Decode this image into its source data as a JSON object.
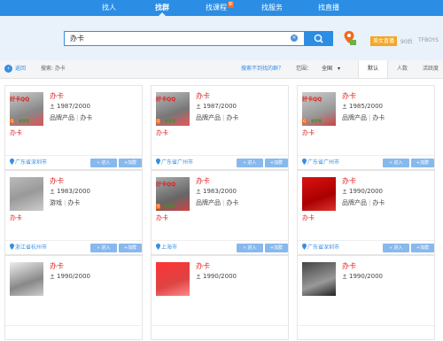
{
  "nav": {
    "tabs": [
      {
        "label": "找人"
      },
      {
        "label": "找群",
        "active": true
      },
      {
        "label": "找课程",
        "badge": "新"
      },
      {
        "label": "找服务"
      },
      {
        "label": "找直播"
      }
    ],
    "accent": "#2b8de3"
  },
  "search": {
    "query": "办卡",
    "live_badge": "美女直播",
    "hot_1": "90后",
    "hot_2": "TFBOYS"
  },
  "filter": {
    "back_label": "返回",
    "search_label": "搜索: 办卡",
    "not_found_question": "搜索不到找的群？",
    "range_label": "范围：",
    "range_value": "全国",
    "sort_default": "默认",
    "sort_people": "人数",
    "sort_active": "活跃度"
  },
  "cards": [
    {
      "name": "办卡",
      "members": "1987/2000",
      "tags": [
        "品牌产品",
        "办卡"
      ],
      "keyword": "办卡",
      "location": "广东省深圳市",
      "enter": "» 进入",
      "join": "+加群",
      "avatar_text": "好卡QQ"
    },
    {
      "name": "办卡",
      "members": "1987/2000",
      "tags": [
        "品牌产品",
        "办卡"
      ],
      "keyword": "办卡",
      "location": "广东省广州市",
      "enter": "» 进入",
      "join": "+加群",
      "avatar_text": "好卡QQ"
    },
    {
      "name": "办卡",
      "members": "1985/2000",
      "tags": [
        "品牌产品",
        "办卡"
      ],
      "keyword": "办卡",
      "location": "广东省广州市",
      "enter": "» 进入",
      "join": "+加群",
      "avatar_text": "好卡QQ"
    },
    {
      "name": "办卡",
      "members": "1983/2000",
      "tags": [
        "游戏",
        "办卡"
      ],
      "keyword": "办卡",
      "location": "浙江省杭州市",
      "enter": "» 进入",
      "join": "+加群",
      "avatar_text": ""
    },
    {
      "name": "办卡",
      "members": "1983/2000",
      "tags": [
        "品牌产品",
        "办卡"
      ],
      "keyword": "办卡",
      "location": "上海市",
      "enter": "» 进入",
      "join": "+加群",
      "avatar_text": "好卡QQ"
    },
    {
      "name": "办卡",
      "members": "1990/2000",
      "tags": [
        "品牌产品",
        "办卡"
      ],
      "keyword": "办卡",
      "location": "广东省深圳市",
      "enter": "» 进入",
      "join": "+加群",
      "avatar_text": ""
    },
    {
      "name": "办卡",
      "members": "1990/2000",
      "tags": [],
      "keyword": "",
      "location": "",
      "enter": "",
      "join": "",
      "avatar_text": ""
    },
    {
      "name": "办卡",
      "members": "1990/2000",
      "tags": [],
      "keyword": "",
      "location": "",
      "enter": "",
      "join": "",
      "avatar_text": ""
    },
    {
      "name": "办卡",
      "members": "1990/2000",
      "tags": [],
      "keyword": "",
      "location": "",
      "enter": "",
      "join": "",
      "avatar_text": ""
    }
  ]
}
